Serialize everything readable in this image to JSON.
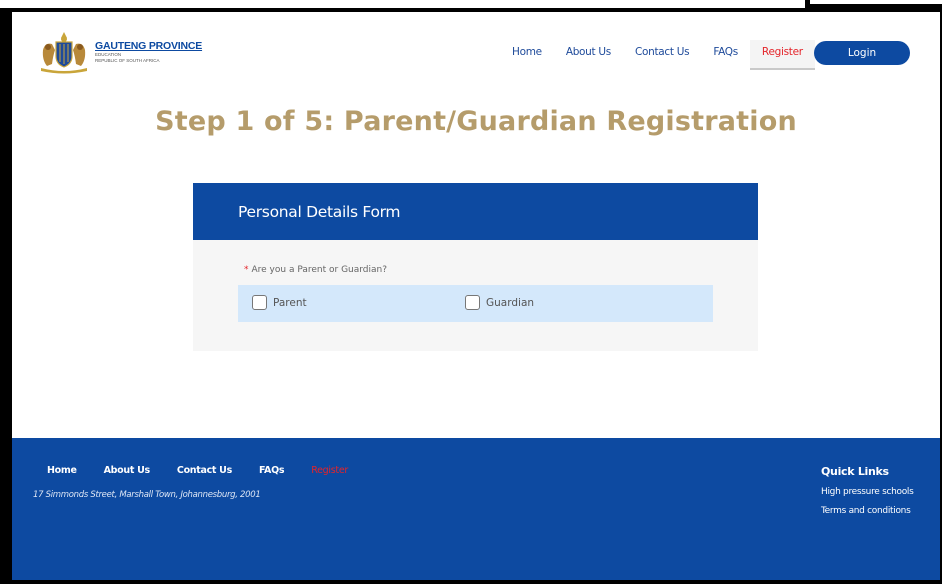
{
  "brand": {
    "title": "GAUTENG PROVINCE",
    "line1": "EDUCATION",
    "line2": "REPUBLIC OF SOUTH AFRICA"
  },
  "nav": {
    "home": "Home",
    "about": "About Us",
    "contact": "Contact Us",
    "faqs": "FAQs",
    "register": "Register",
    "login": "Login"
  },
  "page": {
    "title": "Step 1 of 5: Parent/Guardian Registration"
  },
  "form": {
    "header": "Personal Details Form",
    "required_mark": "*",
    "question": "Are you a Parent or Guardian?",
    "option_parent": "Parent",
    "option_guardian": "Guardian"
  },
  "footer": {
    "nav": {
      "home": "Home",
      "about": "About Us",
      "contact": "Contact Us",
      "faqs": "FAQs",
      "register": "Register"
    },
    "address": "17 Simmonds Street, Marshall Town, Johannesburg, 2001",
    "quick_links_title": "Quick Links",
    "quick_link_1": "High pressure schools",
    "quick_link_2": "Terms and conditions"
  },
  "colors": {
    "primary": "#0d4aa1",
    "accent_gold": "#b59c6b",
    "active_red": "#e4242a",
    "option_bg": "#d4e8fb"
  }
}
